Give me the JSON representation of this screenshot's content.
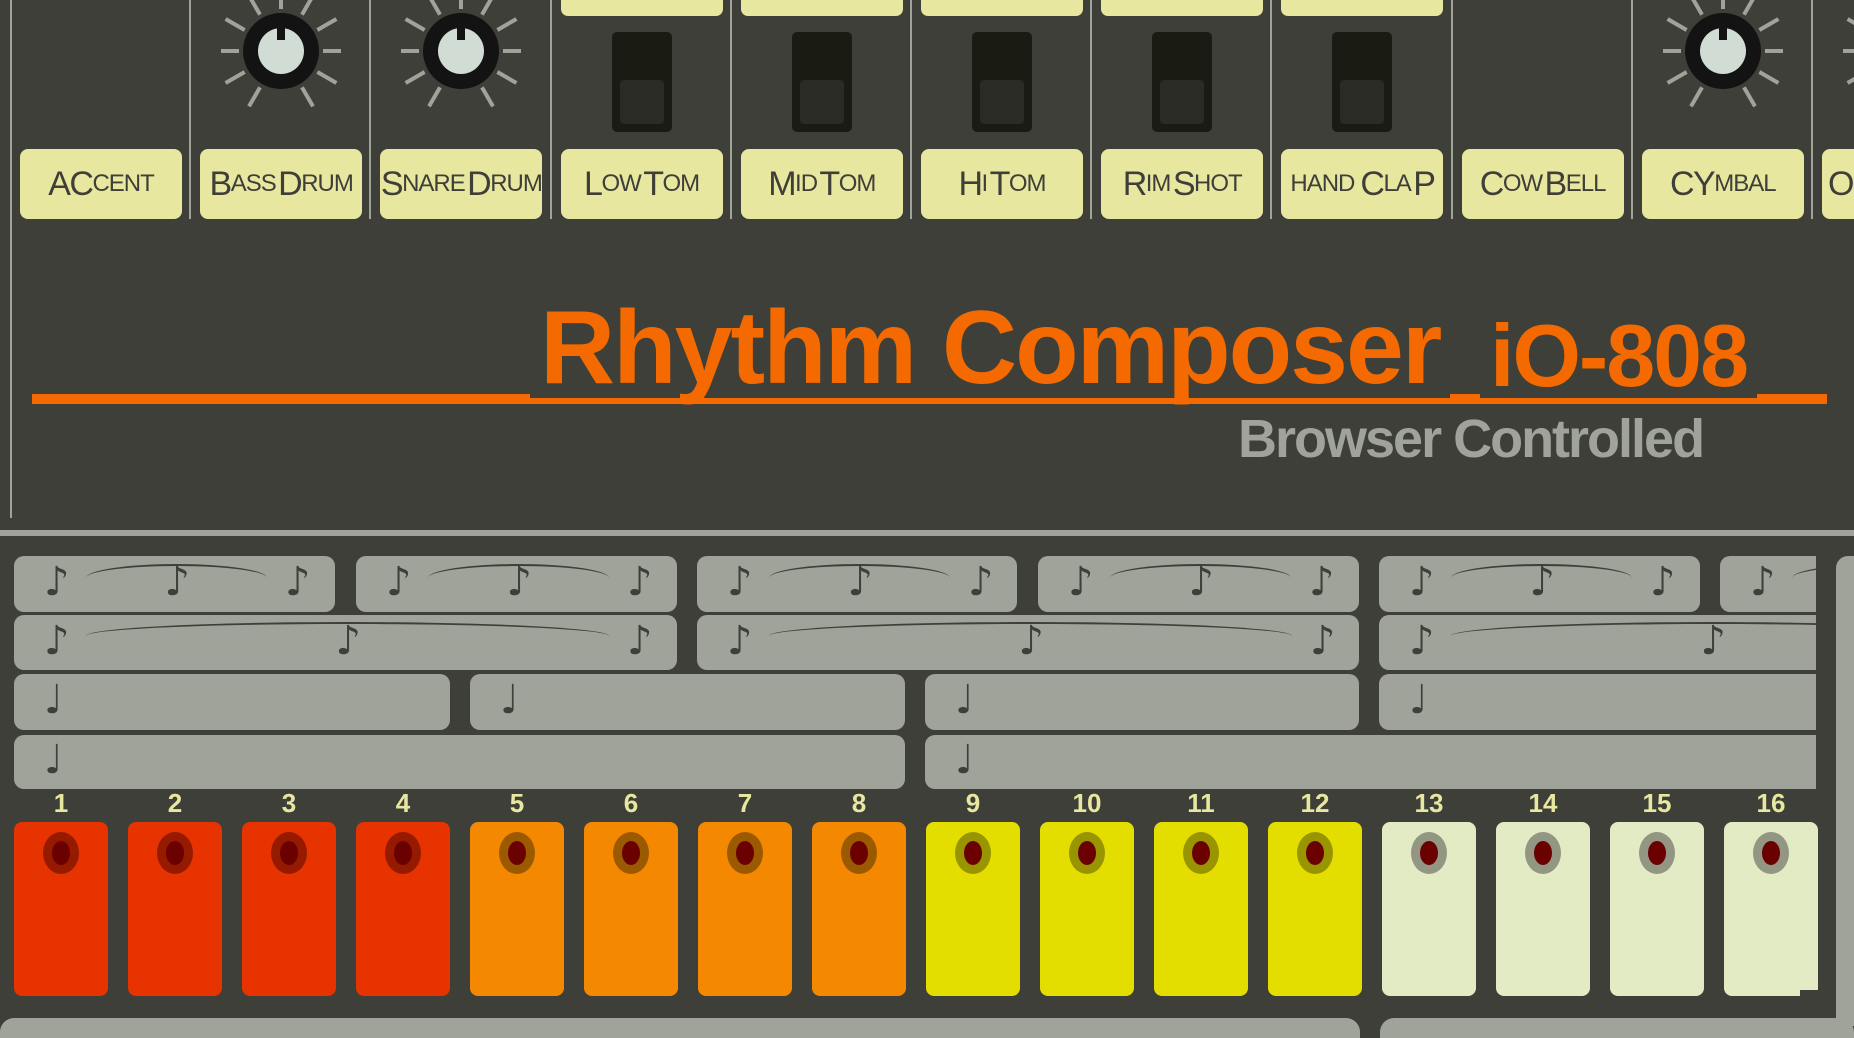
{
  "app": {
    "title": "Rhythm Composer",
    "model": "iO-808",
    "subtitle": "Browser Controlled"
  },
  "colors": {
    "panel": "#3e3f38",
    "accent_orange": "#f46a00",
    "label_yellow": "#e8e7a0",
    "grey": "#a0a39a",
    "step_red": "#e63300",
    "step_orange": "#f48800",
    "step_yellow": "#e4de00",
    "step_white": "#e2ebc3",
    "led_red": "#6b0000"
  },
  "instruments": [
    {
      "label_big": "AC",
      "label_small": "CENT",
      "control": "none"
    },
    {
      "label_big": "B",
      "label_small": "ASS",
      "label_big2": "D",
      "label_small2": "RUM",
      "control": "knob"
    },
    {
      "label_big": "S",
      "label_small": "NARE",
      "label_big2": "D",
      "label_small2": "RUM",
      "control": "knob"
    },
    {
      "label_big": "L",
      "label_small": "OW",
      "label_big2": "T",
      "label_small2": "OM",
      "control": "switch"
    },
    {
      "label_big": "M",
      "label_small": "ID",
      "label_big2": "T",
      "label_small2": "OM",
      "control": "switch"
    },
    {
      "label_big": "H",
      "label_small": "I",
      "label_big2": "T",
      "label_small2": "OM",
      "control": "switch"
    },
    {
      "label_big": "R",
      "label_small": "IM",
      "label_big2": "S",
      "label_small2": "HOT",
      "control": "switch"
    },
    {
      "label_pre": "HAND",
      "label_big": "C",
      "label_small": "LA",
      "label_big2": "P",
      "control": "switch"
    },
    {
      "label_big": "C",
      "label_small": "OW",
      "label_big2": "B",
      "label_small2": "ELL",
      "control": "none"
    },
    {
      "label_big": "CY",
      "label_small": "MBAL",
      "control": "knob"
    },
    {
      "label_big": "O",
      "control": "knob"
    }
  ],
  "note_glyphs": {
    "eighth": "♪",
    "quarter": "♩"
  },
  "steps": [
    {
      "num": "1",
      "color": "red"
    },
    {
      "num": "2",
      "color": "red"
    },
    {
      "num": "3",
      "color": "red"
    },
    {
      "num": "4",
      "color": "red"
    },
    {
      "num": "5",
      "color": "orange"
    },
    {
      "num": "6",
      "color": "orange"
    },
    {
      "num": "7",
      "color": "orange"
    },
    {
      "num": "8",
      "color": "orange"
    },
    {
      "num": "9",
      "color": "yellow"
    },
    {
      "num": "10",
      "color": "yellow"
    },
    {
      "num": "11",
      "color": "yellow"
    },
    {
      "num": "12",
      "color": "yellow"
    },
    {
      "num": "13",
      "color": "white"
    },
    {
      "num": "14",
      "color": "white"
    },
    {
      "num": "15",
      "color": "white"
    },
    {
      "num": "16",
      "color": "white"
    }
  ]
}
